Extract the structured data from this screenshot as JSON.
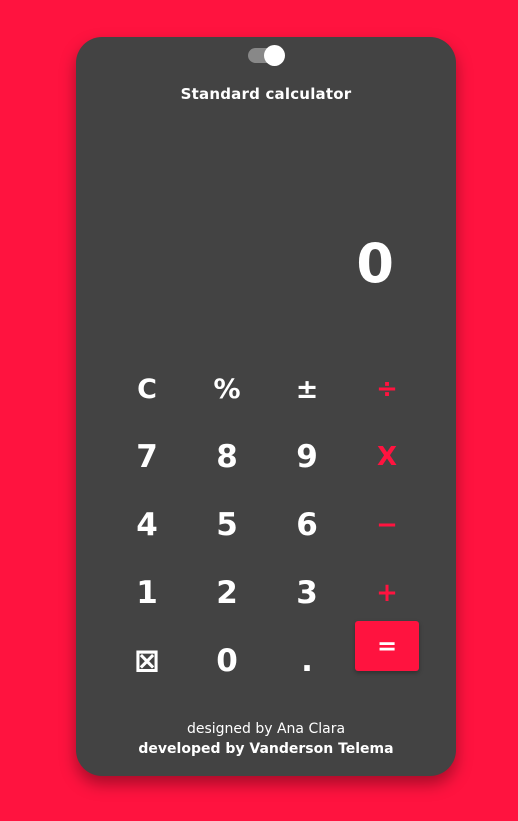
{
  "header": {
    "title": "Standard calculator"
  },
  "display": {
    "value": "0"
  },
  "keys": {
    "clear": "C",
    "percent": "%",
    "plus_minus": "±",
    "divide": "÷",
    "seven": "7",
    "eight": "8",
    "nine": "9",
    "multiply": "X",
    "four": "4",
    "five": "5",
    "six": "6",
    "subtract": "−",
    "one": "1",
    "two": "2",
    "three": "3",
    "add": "+",
    "backspace": "⊠",
    "zero": "0",
    "decimal": ".",
    "equals": "="
  },
  "footer": {
    "designed_by": "designed by Ana Clara",
    "developed_by": "developed by Vanderson Telema"
  },
  "colors": {
    "background": "#ff133f",
    "card": "#434343",
    "accent": "#ff133f",
    "text": "#ffffff"
  }
}
